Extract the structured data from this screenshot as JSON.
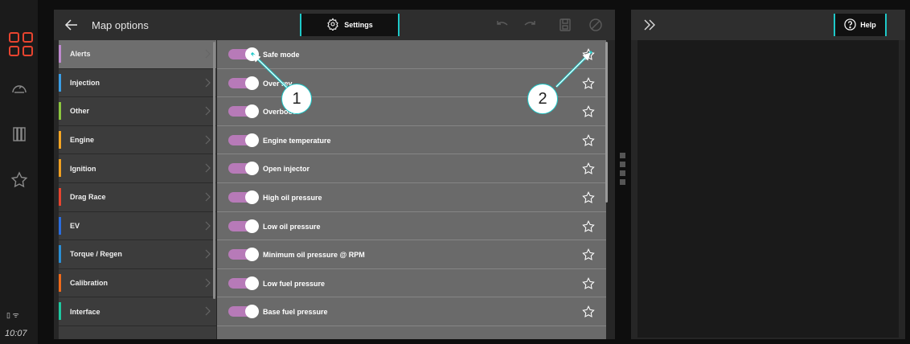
{
  "rail": {
    "status": "▯ ᯤ",
    "time": "10:07",
    "icons": [
      "apps-icon",
      "gauge-icon",
      "columns-icon",
      "star-icon"
    ]
  },
  "main": {
    "title": "Map options",
    "settings_label": "Settings"
  },
  "right": {
    "help_label": "Help"
  },
  "categories": [
    {
      "label": "Alerts",
      "color": "#c08ad0"
    },
    {
      "label": "Injection",
      "color": "#3a9ee6"
    },
    {
      "label": "Other",
      "color": "#8cc63f"
    },
    {
      "label": "Engine",
      "color": "#f5a623"
    },
    {
      "label": "Ignition",
      "color": "#f0a020"
    },
    {
      "label": "Drag Race",
      "color": "#e8442f"
    },
    {
      "label": "EV",
      "color": "#2a6de0"
    },
    {
      "label": "Torque / Regen",
      "color": "#2a8fd6"
    },
    {
      "label": "Calibration",
      "color": "#f06a1a"
    },
    {
      "label": "Interface",
      "color": "#1ec8a0"
    }
  ],
  "options": [
    {
      "label": "Safe mode",
      "enabled": true
    },
    {
      "label": "Over rev",
      "enabled": true
    },
    {
      "label": "Overboost",
      "enabled": true
    },
    {
      "label": "Engine temperature",
      "enabled": true
    },
    {
      "label": "Open injector",
      "enabled": true
    },
    {
      "label": "High oil pressure",
      "enabled": true
    },
    {
      "label": "Low oil pressure",
      "enabled": true
    },
    {
      "label": "Minimum oil pressure @ RPM",
      "enabled": true
    },
    {
      "label": "Low fuel pressure",
      "enabled": true
    },
    {
      "label": "Base fuel pressure",
      "enabled": true
    }
  ],
  "callouts": [
    "1",
    "2"
  ],
  "colors": {
    "accent": "#1ec8c8",
    "toggle": "#b77ab8",
    "brand": "#e8442f"
  }
}
